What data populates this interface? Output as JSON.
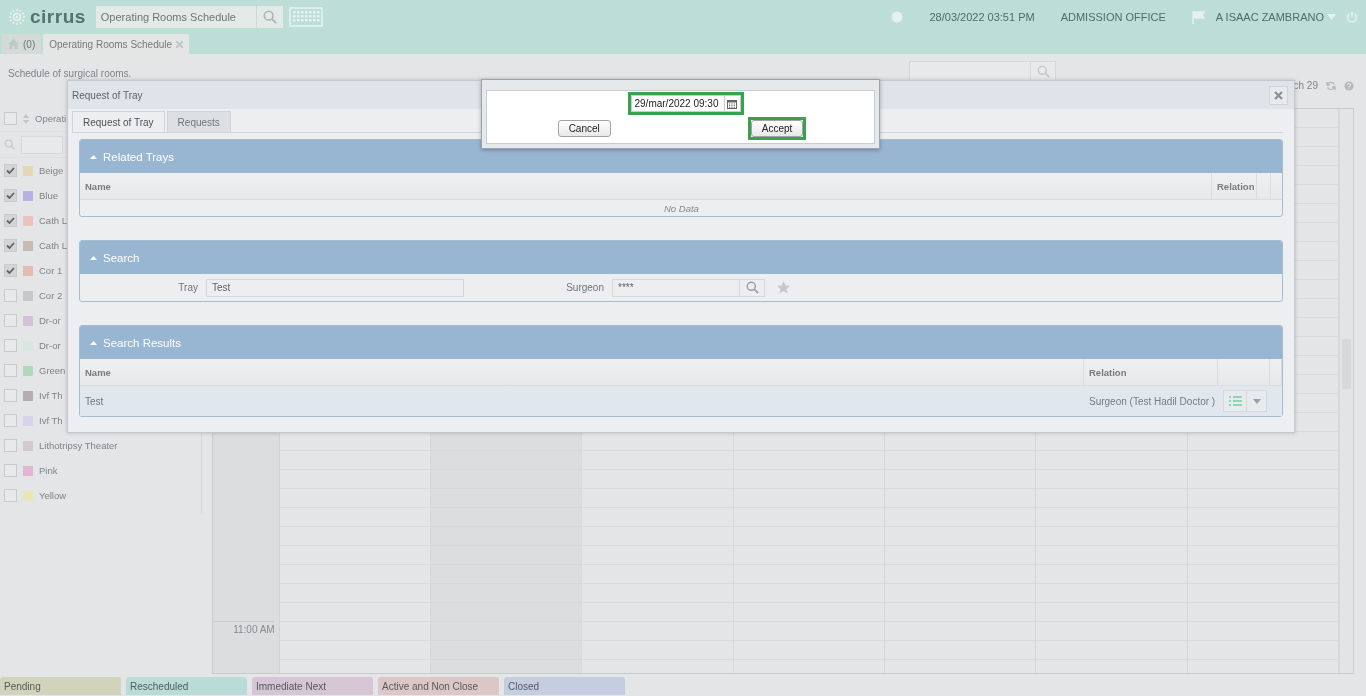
{
  "header": {
    "logo": "cirrus",
    "search": {
      "value": "Operating Rooms Schedule"
    },
    "datetime": "28/03/2022 03:51 PM",
    "office": "ADMISSION OFFICE",
    "user": "A ISAAC ZAMBRANO"
  },
  "tabs": [
    {
      "label": "(0)",
      "kind": "home",
      "selected": false
    },
    {
      "label": "Operating Rooms Schedule",
      "kind": "page",
      "selected": true
    }
  ],
  "page": {
    "subtitle": "Schedule of surgical rooms."
  },
  "rooms": {
    "header": "Operati",
    "all_checked": false,
    "items": [
      {
        "name": "Beige",
        "checked": true,
        "color": "#e6d6b4"
      },
      {
        "name": "Blue",
        "checked": true,
        "color": "#b4b2e2"
      },
      {
        "name": "Cath L",
        "checked": true,
        "color": "#e8c4bc"
      },
      {
        "name": "Cath L",
        "checked": true,
        "color": "#c4bcb4"
      },
      {
        "name": "Cor 1",
        "checked": true,
        "color": "#e2bcb2"
      },
      {
        "name": "Cor 2",
        "checked": false,
        "color": "#c8c8c8"
      },
      {
        "name": "Dr-or",
        "checked": false,
        "color": "#d2c2d6"
      },
      {
        "name": "Dr-or",
        "checked": false,
        "color": "#d6e8e0"
      },
      {
        "name": "Green",
        "checked": false,
        "color": "#b2d8ba"
      },
      {
        "name": "Ivf Th",
        "checked": false,
        "color": "#b4aeb4"
      },
      {
        "name": "Ivf Th",
        "checked": false,
        "color": "#d8d2ea"
      },
      {
        "name": "Lithotripsy Theater",
        "checked": false,
        "color": "#d2c8d2"
      },
      {
        "name": "Pink",
        "checked": false,
        "color": "#e2b4d2"
      },
      {
        "name": "Yellow",
        "checked": false,
        "color": "#e8e8b4"
      }
    ]
  },
  "calendar": {
    "date_label": "ch 29",
    "time_label": "11:00 AM"
  },
  "legend": [
    {
      "label": "Pending",
      "color": "#d2d3bb"
    },
    {
      "label": "Rescheduled",
      "color": "#b9ddd6"
    },
    {
      "label": "Immediate Next",
      "color": "#d5c5d5"
    },
    {
      "label": "Active and Non Close",
      "color": "#dcc6c6"
    },
    {
      "label": "Closed",
      "color": "#c5cde0"
    }
  ],
  "tray_modal": {
    "title": "Request of Tray",
    "tabs": [
      {
        "label": "Request of Tray",
        "selected": true
      },
      {
        "label": "Requests",
        "selected": false
      }
    ],
    "related_trays": {
      "title": "Related Trays",
      "columns": [
        "Name",
        "Relation"
      ],
      "empty_text": "No Data"
    },
    "search": {
      "title": "Search",
      "fields": [
        {
          "label": "Tray",
          "value": "Test",
          "kind": "text"
        },
        {
          "label": "Surgeon",
          "value": "****",
          "kind": "lookup"
        }
      ]
    },
    "results": {
      "title": "Search Results",
      "columns": [
        "Name",
        "Relation"
      ],
      "rows": [
        {
          "name": "Test",
          "relation": "Surgeon (Test Hadil Doctor )"
        }
      ]
    }
  },
  "date_dialog": {
    "date": {
      "value": "29/mar/2022 09:30",
      "highlighted": true
    },
    "buttons": [
      {
        "label": "Cancel",
        "highlighted": false
      },
      {
        "label": "Accept",
        "highlighted": true
      }
    ]
  }
}
